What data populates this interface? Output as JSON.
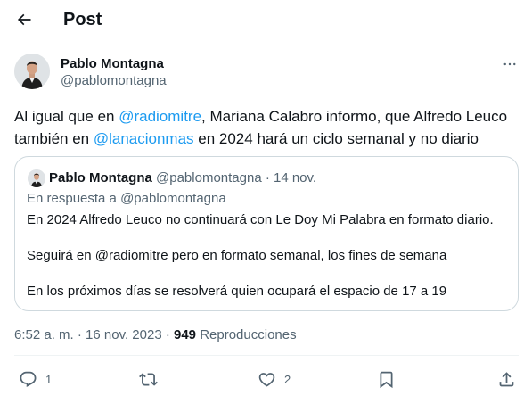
{
  "header": {
    "title": "Post",
    "back_icon": "arrow-left-icon"
  },
  "author": {
    "name": "Pablo Montagna",
    "handle": "@pablomontagna"
  },
  "tweet": {
    "seg1": "Al igual que en ",
    "mention1": "@radiomitre",
    "seg2": ", Mariana Calabro informo, que Alfredo Leuco también en ",
    "mention2": "@lanacionmas",
    "seg3": " en 2024 hará un ciclo semanal y no diario"
  },
  "quote": {
    "name": "Pablo Montagna",
    "meta": "@pablomontagna · 14 nov.",
    "reply_to": "En respuesta a @pablomontagna",
    "line1": "En 2024 Alfredo Leuco no continuará con Le Doy Mi Palabra en formato diario.",
    "line2": "Seguirá en @radiomitre pero en formato semanal, los fines de semana",
    "line3": "En los próximos días se resolverá quien ocupará el espacio de 17 a 19"
  },
  "meta": {
    "time": "6:52 a. m. · 16 nov. 2023 · ",
    "views": "949",
    "views_label": " Reproducciones"
  },
  "actions": {
    "replies": "1",
    "retweets": "",
    "likes": "2"
  },
  "colors": {
    "accent": "#1d9bf0",
    "muted": "#536471",
    "text": "#0f1419",
    "border": "#cfd9de"
  }
}
